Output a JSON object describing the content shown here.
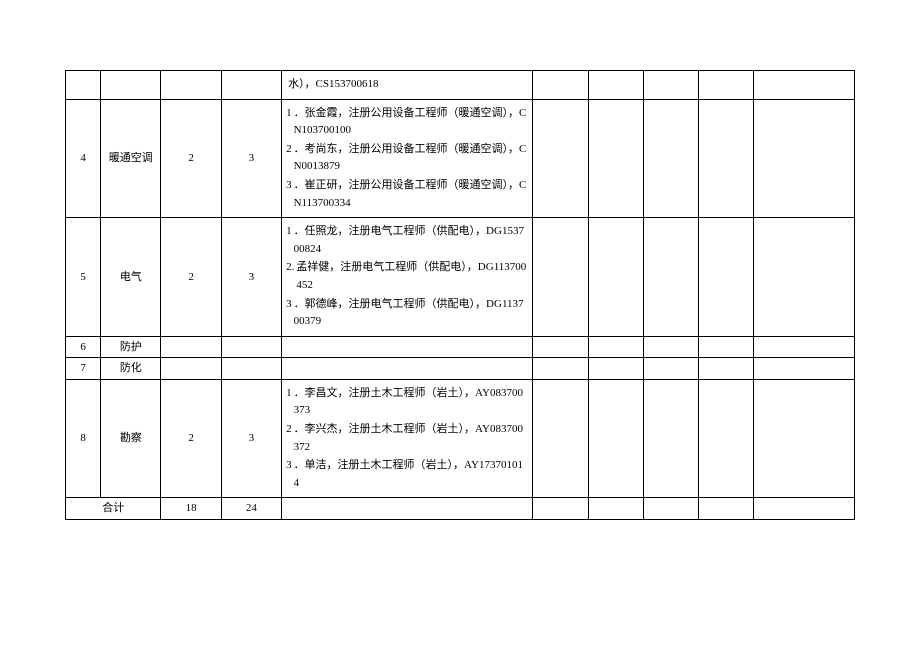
{
  "rows": [
    {
      "idx": "",
      "name": "",
      "n1": "",
      "n2": "",
      "details": [
        {
          "num": "",
          "text": "水），CS153700618"
        }
      ]
    },
    {
      "idx": "4",
      "name": "暖通空调",
      "n1": "2",
      "n2": "3",
      "details": [
        {
          "num": "1",
          "text": "．张金霞，注册公用设备工程师（暖通空调），CN103700100"
        },
        {
          "num": "2",
          "text": "．考尚东，注册公用设备工程师（暖通空调），CN0013879"
        },
        {
          "num": "3",
          "text": "．崔正研，注册公用设备工程师（暖通空调），CN113700334"
        }
      ]
    },
    {
      "idx": "5",
      "name": "电气",
      "n1": "2",
      "n2": "3",
      "details": [
        {
          "num": "1",
          "text": "．任照龙，注册电气工程师（供配电），DG153700824"
        },
        {
          "num": "2.",
          "text": "孟祥健，注册电气工程师（供配电），DG113700452"
        },
        {
          "num": "3",
          "text": "．郭德峰，注册电气工程师（供配电），DG113700379"
        }
      ]
    },
    {
      "idx": "6",
      "name": "防护",
      "n1": "",
      "n2": "",
      "details": []
    },
    {
      "idx": "7",
      "name": "防化",
      "n1": "",
      "n2": "",
      "details": []
    },
    {
      "idx": "8",
      "name": "勘察",
      "n1": "2",
      "n2": "3",
      "details": [
        {
          "num": "1",
          "text": "．李昌文，注册土木工程师（岩土），AY083700373"
        },
        {
          "num": "2",
          "text": "．李兴杰，注册土木工程师（岩土），AY083700372"
        },
        {
          "num": "3",
          "text": "．单洁，注册土木工程师（岩土），AY173701014"
        }
      ]
    }
  ],
  "total": {
    "label": "合计",
    "n1": "18",
    "n2": "24"
  }
}
